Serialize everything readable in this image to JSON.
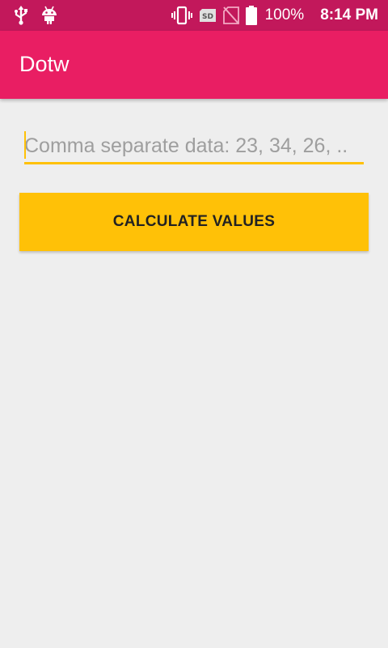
{
  "status_bar": {
    "icons_left": [
      "usb-icon",
      "android-icon"
    ],
    "icons_right": [
      "vibrate-icon",
      "sd-card-icon",
      "no-signal-icon",
      "battery-icon"
    ],
    "sd_label": "SD",
    "battery": "100%",
    "time": "8:14 PM",
    "color": "#c2185b"
  },
  "app_bar": {
    "title": "Dotw",
    "color": "#e91e63"
  },
  "main": {
    "input": {
      "placeholder": "Comma separate data: 23, 34, 26, ..",
      "value": ""
    },
    "button": {
      "label": "CALCULATE VALUES",
      "color": "#ffc107"
    }
  }
}
